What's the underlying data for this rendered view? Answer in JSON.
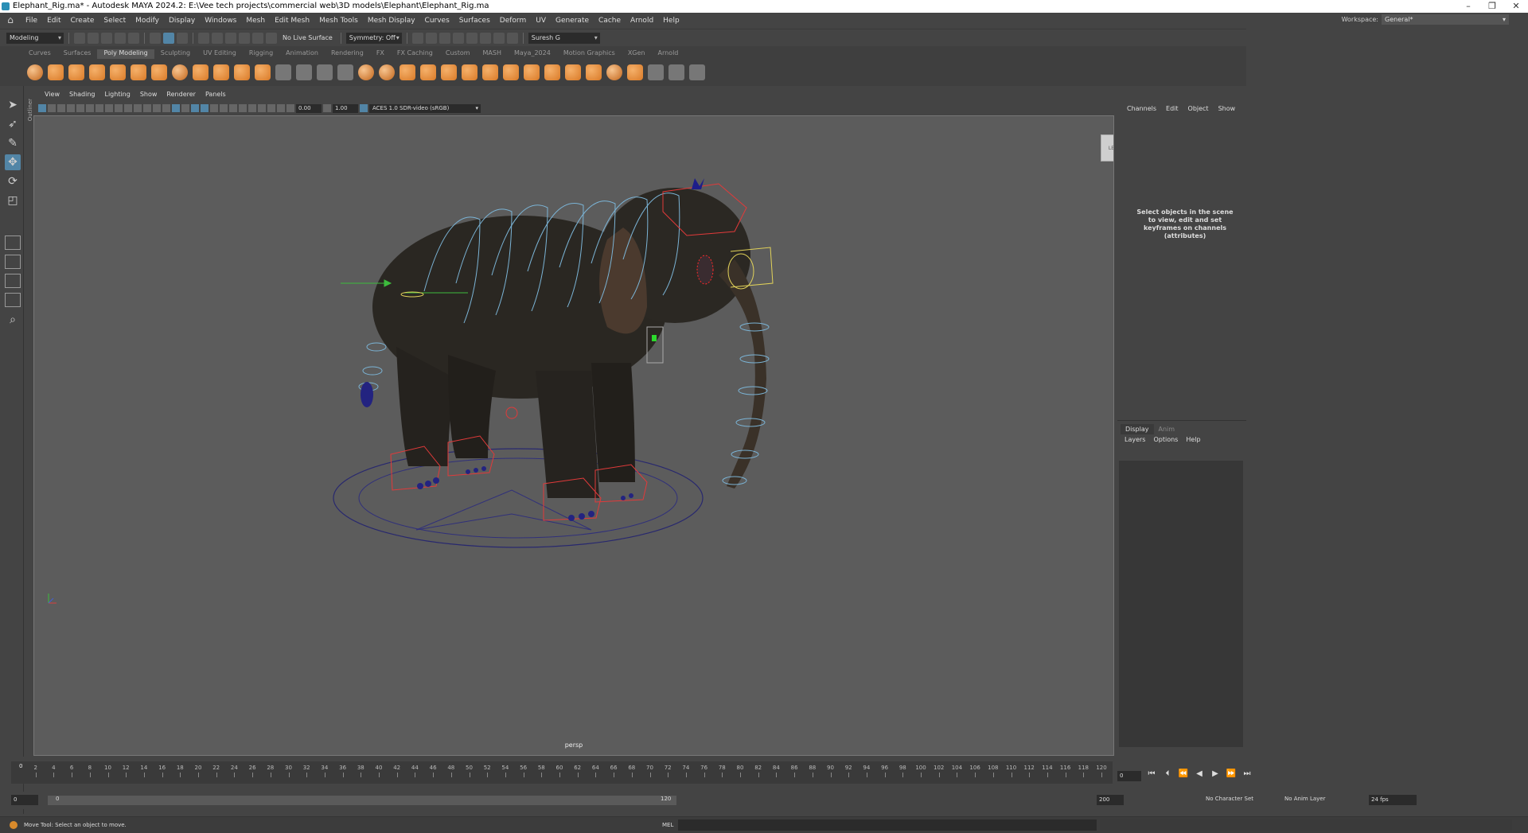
{
  "window": {
    "title": "Elephant_Rig.ma* - Autodesk MAYA 2024.2: E:\\Vee tech projects\\commercial web\\3D models\\Elephant\\Elephant_Rig.ma",
    "controls": [
      "–",
      "❐",
      "✕"
    ]
  },
  "menubar": {
    "items": [
      "File",
      "Edit",
      "Create",
      "Select",
      "Modify",
      "Display",
      "Windows",
      "Mesh",
      "Edit Mesh",
      "Mesh Tools",
      "Mesh Display",
      "Curves",
      "Surfaces",
      "Deform",
      "UV",
      "Generate",
      "Cache",
      "Arnold",
      "Help"
    ],
    "workspace_label": "Workspace:",
    "workspace_value": "General*"
  },
  "statusline": {
    "menuset": "Modeling",
    "live_surface": "No Live Surface",
    "symmetry": "Symmetry: Off",
    "user": "Suresh G"
  },
  "shelf": {
    "tabs": [
      "Curves",
      "Surfaces",
      "Poly Modeling",
      "Sculpting",
      "UV Editing",
      "Rigging",
      "Animation",
      "Rendering",
      "FX",
      "FX Caching",
      "Custom",
      "MASH",
      "Maya_2024",
      "Motion Graphics",
      "XGen",
      "Arnold"
    ],
    "active_tab": "Poly Modeling"
  },
  "panel": {
    "menus": [
      "View",
      "Shading",
      "Lighting",
      "Show",
      "Renderer",
      "Panels"
    ],
    "exposure": "0.00",
    "gamma": "1.00",
    "color_space": "ACES 1.0 SDR-video (sRGB)",
    "camera": "persp",
    "viewcube_label": "LEFT"
  },
  "outliner_label": "Outliner",
  "channelbox": {
    "menus": [
      "Channels",
      "Edit",
      "Object",
      "Show"
    ],
    "message": "Select objects in the scene to view, edit and set keyframes on channels (attributes)"
  },
  "layers": {
    "tabs": [
      "Display",
      "Anim"
    ],
    "menus": [
      "Layers",
      "Options",
      "Help"
    ]
  },
  "timeslider": {
    "ticks": [
      "2",
      "4",
      "6",
      "8",
      "10",
      "12",
      "14",
      "16",
      "18",
      "20",
      "22",
      "24",
      "26",
      "28",
      "30",
      "32",
      "34",
      "36",
      "38",
      "40",
      "42",
      "44",
      "46",
      "48",
      "50",
      "52",
      "54",
      "56",
      "58",
      "60",
      "62",
      "64",
      "66",
      "68",
      "70",
      "72",
      "74",
      "76",
      "78",
      "80",
      "82",
      "84",
      "86",
      "88",
      "90",
      "92",
      "94",
      "96",
      "98",
      "100",
      "102",
      "104",
      "106",
      "108",
      "110",
      "112",
      "114",
      "116",
      "118",
      "120"
    ],
    "current": "0",
    "current_field": "0"
  },
  "rangeslider": {
    "start": "0",
    "inner_start": "0",
    "inner_end": "120",
    "end": "200",
    "character_set": "No Character Set",
    "anim_layer": "No Anim Layer",
    "fps": "24 fps"
  },
  "helpline": {
    "message": "Move Tool: Select an object to move.",
    "mel_label": "MEL"
  },
  "colors": {
    "viewport_bg": "#5c5c5c",
    "accent": "#5285a6",
    "shelf_icon": "#d97a27"
  }
}
